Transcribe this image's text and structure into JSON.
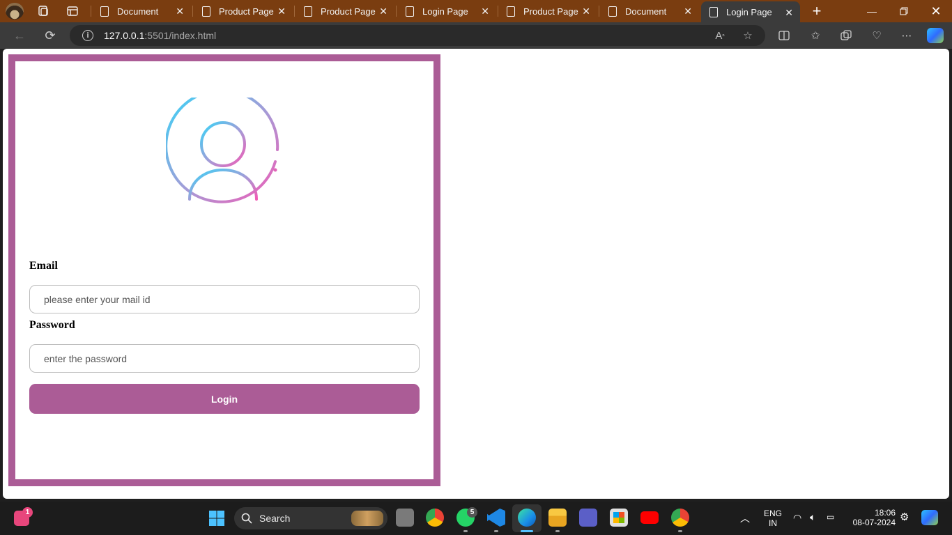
{
  "browser": {
    "tabs": [
      {
        "label": "Document",
        "active": false
      },
      {
        "label": "Product Page",
        "active": false
      },
      {
        "label": "Product Page",
        "active": false
      },
      {
        "label": "Login Page",
        "active": false
      },
      {
        "label": "Product Page",
        "active": false
      },
      {
        "label": "Document",
        "active": false
      },
      {
        "label": "Login Page",
        "active": true
      }
    ],
    "url_host": "127.0.0.1",
    "url_rest": ":5501/index.html",
    "colors": {
      "tabstrip": "#7a3d10",
      "toolbar": "#3b3b3b"
    }
  },
  "page": {
    "email_label": "Email",
    "email_placeholder": "please enter your mail id",
    "password_label": "Password",
    "password_placeholder": "enter the password",
    "login_button": "Login",
    "accent_color": "#ab5c96",
    "avatar_icon": "user-circle-icon"
  },
  "taskbar": {
    "search_label": "Search",
    "notification_badge": "1",
    "whatsapp_badge": "5",
    "language_line1": "ENG",
    "language_line2": "IN",
    "time": "18:06",
    "date": "08-07-2024"
  }
}
